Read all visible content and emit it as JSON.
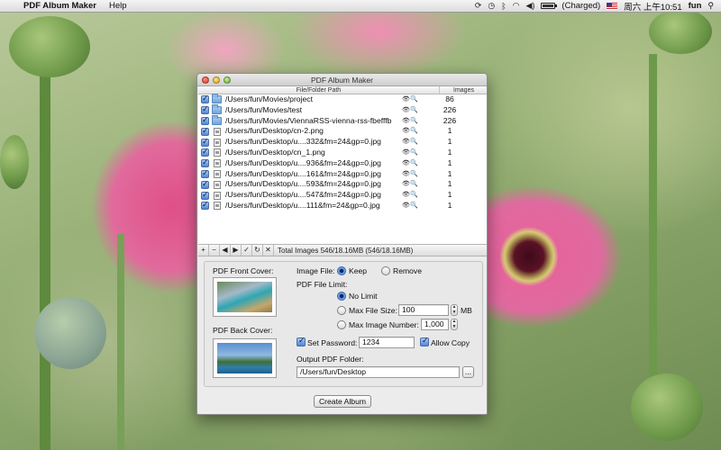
{
  "menubar": {
    "app_name": "PDF Album Maker",
    "menus": [
      "Help"
    ],
    "battery_status": "(Charged)",
    "clock": "周六 上午10:51",
    "user": "fun"
  },
  "window": {
    "title": "PDF Album Maker",
    "table": {
      "headers": {
        "path": "File/Folder Path",
        "images": "Images"
      },
      "rows": [
        {
          "type": "folder",
          "path": "/Users/fun/Movies/project",
          "images": "86"
        },
        {
          "type": "folder",
          "path": "/Users/fun/Movies/test",
          "images": "226"
        },
        {
          "type": "folder",
          "path": "/Users/fun/Movies/ViennaRSS-vienna-rss-fbefffb",
          "images": "226"
        },
        {
          "type": "file",
          "path": "/Users/fun/Desktop/cn-2.png",
          "images": "1"
        },
        {
          "type": "file",
          "path": "/Users/fun/Desktop/u....332&fm=24&gp=0.jpg",
          "images": "1"
        },
        {
          "type": "file",
          "path": "/Users/fun/Desktop/cn_1.png",
          "images": "1"
        },
        {
          "type": "file",
          "path": "/Users/fun/Desktop/u....936&fm=24&gp=0.jpg",
          "images": "1"
        },
        {
          "type": "file",
          "path": "/Users/fun/Desktop/u....161&fm=24&gp=0.jpg",
          "images": "1"
        },
        {
          "type": "file",
          "path": "/Users/fun/Desktop/u....593&fm=24&gp=0.jpg",
          "images": "1"
        },
        {
          "type": "file",
          "path": "/Users/fun/Desktop/u....547&fm=24&gp=0.jpg",
          "images": "1"
        },
        {
          "type": "file",
          "path": "/Users/fun/Desktop/u....111&fm=24&gp=0.jpg",
          "images": "1"
        }
      ]
    },
    "toolbar": {
      "buttons": [
        "+",
        "−",
        "◀",
        "▶",
        "✓",
        "↻",
        "✕"
      ],
      "total": "Total Images 546/18.16MB (546/18.16MB)"
    },
    "options": {
      "front_cover_label": "PDF Front Cover:",
      "back_cover_label": "PDF Back Cover:",
      "image_file_label": "Image File:",
      "keep_label": "Keep",
      "remove_label": "Remove",
      "file_limit_label": "PDF File Limit:",
      "no_limit_label": "No Limit",
      "max_file_size_label": "Max File Size:",
      "max_file_size_value": "100",
      "max_file_size_unit": "MB",
      "max_image_number_label": "Max Image Number:",
      "max_image_number_value": "1,000",
      "set_password_label": "Set Password:",
      "password_value": "1234",
      "allow_copy_label": "Allow Copy",
      "output_folder_label": "Output PDF Folder:",
      "output_folder_value": "/Users/fun/Desktop",
      "browse_label": "..."
    },
    "create_button": "Create Album"
  }
}
